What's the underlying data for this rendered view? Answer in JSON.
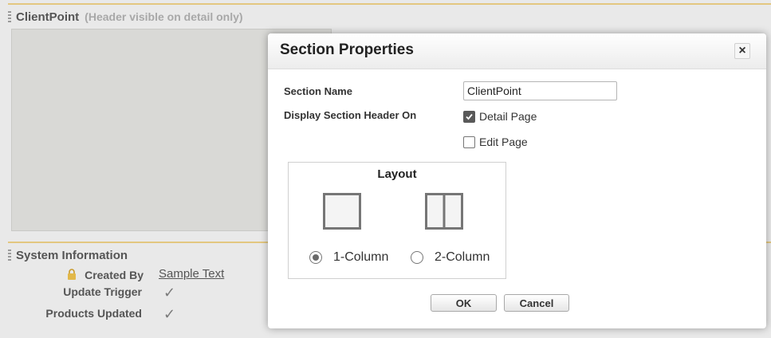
{
  "background": {
    "clientpoint_section": {
      "title": "ClientPoint",
      "subtitle": "(Header visible on detail only)"
    },
    "system_section": {
      "title": "System Information",
      "fields": [
        {
          "label": "Created By",
          "value": "Sample Text",
          "locked": true
        },
        {
          "label": "Update Trigger",
          "checked": true
        },
        {
          "label": "Products Updated",
          "checked": true
        }
      ]
    }
  },
  "dialog": {
    "title": "Section Properties",
    "close_glyph": "×",
    "section_name_label": "Section Name",
    "section_name_value": "ClientPoint",
    "display_header_label": "Display Section Header On",
    "detail_page_label": "Detail Page",
    "detail_page_checked": true,
    "edit_page_label": "Edit Page",
    "edit_page_checked": false,
    "layout": {
      "title": "Layout",
      "options": [
        {
          "label": "1-Column",
          "selected": true
        },
        {
          "label": "2-Column",
          "selected": false
        }
      ]
    },
    "ok_label": "OK",
    "cancel_label": "Cancel"
  },
  "colors": {
    "section_border": "#e3c780",
    "page_background": "#e9e9e9",
    "canvas_background": "#d9d9d6"
  }
}
